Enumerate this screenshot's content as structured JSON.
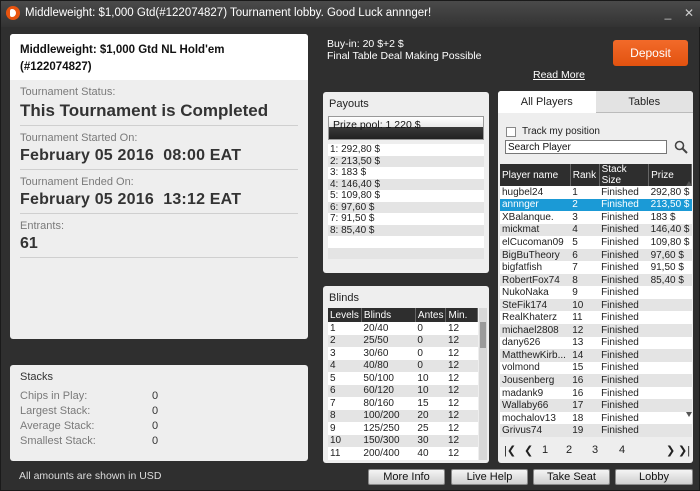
{
  "window": {
    "title": "Middleweight: $1,000 Gtd(#122074827) Tournament lobby. Good Luck annnger!",
    "minimize_glyph": "_",
    "close_glyph": "✕"
  },
  "info": {
    "name_line1": "Middleweight: $1,000 Gtd NL Hold'em",
    "name_line2": "(#122074827)",
    "status_label": "Tournament Status:",
    "status_value": "This Tournament is Completed",
    "started_label": "Tournament Started On:",
    "started_value": "February 05 2016  08:00 EAT",
    "ended_label": "Tournament Ended On:",
    "ended_value": "February 05 2016  13:12 EAT",
    "entrants_label": "Entrants:",
    "entrants_value": "61"
  },
  "stacks": {
    "title": "Stacks",
    "rows": [
      {
        "label": "Chips in Play:",
        "value": "0"
      },
      {
        "label": "Largest Stack:",
        "value": "0"
      },
      {
        "label": "Average Stack:",
        "value": "0"
      },
      {
        "label": "Smallest Stack:",
        "value": "0"
      }
    ]
  },
  "footnote": "All amounts are shown in USD",
  "header": {
    "buyin": "Buy-in: 20 $+2 $",
    "deal": "Final Table Deal Making Possible",
    "read_more": "Read More",
    "deposit": "Deposit"
  },
  "payouts": {
    "title": "Payouts",
    "prize_pool": "Prize pool: 1 220 $",
    "items": [
      "1: 292,80 $",
      "2: 213,50 $",
      "3: 183 $",
      "4: 146,40 $",
      "5: 109,80 $",
      "6: 97,60 $",
      "7: 91,50 $",
      "8: 85,40 $",
      "",
      ""
    ]
  },
  "blinds": {
    "title": "Blinds",
    "headers": [
      "Levels",
      "Blinds",
      "Antes",
      "Min."
    ],
    "rows": [
      [
        "1",
        "20/40",
        "0",
        "12"
      ],
      [
        "2",
        "25/50",
        "0",
        "12"
      ],
      [
        "3",
        "30/60",
        "0",
        "12"
      ],
      [
        "4",
        "40/80",
        "0",
        "12"
      ],
      [
        "5",
        "50/100",
        "10",
        "12"
      ],
      [
        "6",
        "60/120",
        "10",
        "12"
      ],
      [
        "7",
        "80/160",
        "15",
        "12"
      ],
      [
        "8",
        "100/200",
        "20",
        "12"
      ],
      [
        "9",
        "125/250",
        "25",
        "12"
      ],
      [
        "10",
        "150/300",
        "30",
        "12"
      ],
      [
        "11",
        "200/400",
        "40",
        "12"
      ]
    ]
  },
  "players": {
    "tabs": [
      "All Players",
      "Tables"
    ],
    "track_label": "Track my position",
    "search_placeholder": "Search Player",
    "headers": [
      "Player name",
      "Rank",
      "Stack Size",
      "Prize"
    ],
    "selected_index": 1,
    "rows": [
      [
        "hugbel24",
        "1",
        "Finished",
        "292,80 $"
      ],
      [
        "annnger",
        "2",
        "Finished",
        "213,50 $"
      ],
      [
        "XBalanque.",
        "3",
        "Finished",
        "183 $"
      ],
      [
        "mickmat",
        "4",
        "Finished",
        "146,40 $"
      ],
      [
        "elCucoman09",
        "5",
        "Finished",
        "109,80 $"
      ],
      [
        "BigBuTheory",
        "6",
        "Finished",
        "97,60 $"
      ],
      [
        "bigfatfish",
        "7",
        "Finished",
        "91,50 $"
      ],
      [
        "RobertFox74",
        "8",
        "Finished",
        "85,40 $"
      ],
      [
        "NukoNaka",
        "9",
        "Finished",
        ""
      ],
      [
        "SteFik174",
        "10",
        "Finished",
        ""
      ],
      [
        "RealKhaterz",
        "11",
        "Finished",
        ""
      ],
      [
        "michael2808",
        "12",
        "Finished",
        ""
      ],
      [
        "dany626",
        "13",
        "Finished",
        ""
      ],
      [
        "MatthewKirb...",
        "14",
        "Finished",
        ""
      ],
      [
        "volmond",
        "15",
        "Finished",
        ""
      ],
      [
        "Jousenberg",
        "16",
        "Finished",
        ""
      ],
      [
        "madank9",
        "16",
        "Finished",
        ""
      ],
      [
        "Wallaby66",
        "17",
        "Finished",
        ""
      ],
      [
        "mochalov13",
        "18",
        "Finished",
        ""
      ],
      [
        "Grivus74",
        "19",
        "Finished",
        ""
      ]
    ],
    "pager": {
      "first": "|❮",
      "prev": "❮",
      "pages": [
        "1",
        "2",
        "3",
        "4"
      ],
      "next": "❯",
      "last": "❯|"
    }
  },
  "buttons": {
    "more_info": "More Info",
    "live_help": "Live Help",
    "take_seat": "Take Seat",
    "lobby": "Lobby"
  },
  "colors": {
    "accent": "#e2520f",
    "selection": "#1b9ad6"
  }
}
